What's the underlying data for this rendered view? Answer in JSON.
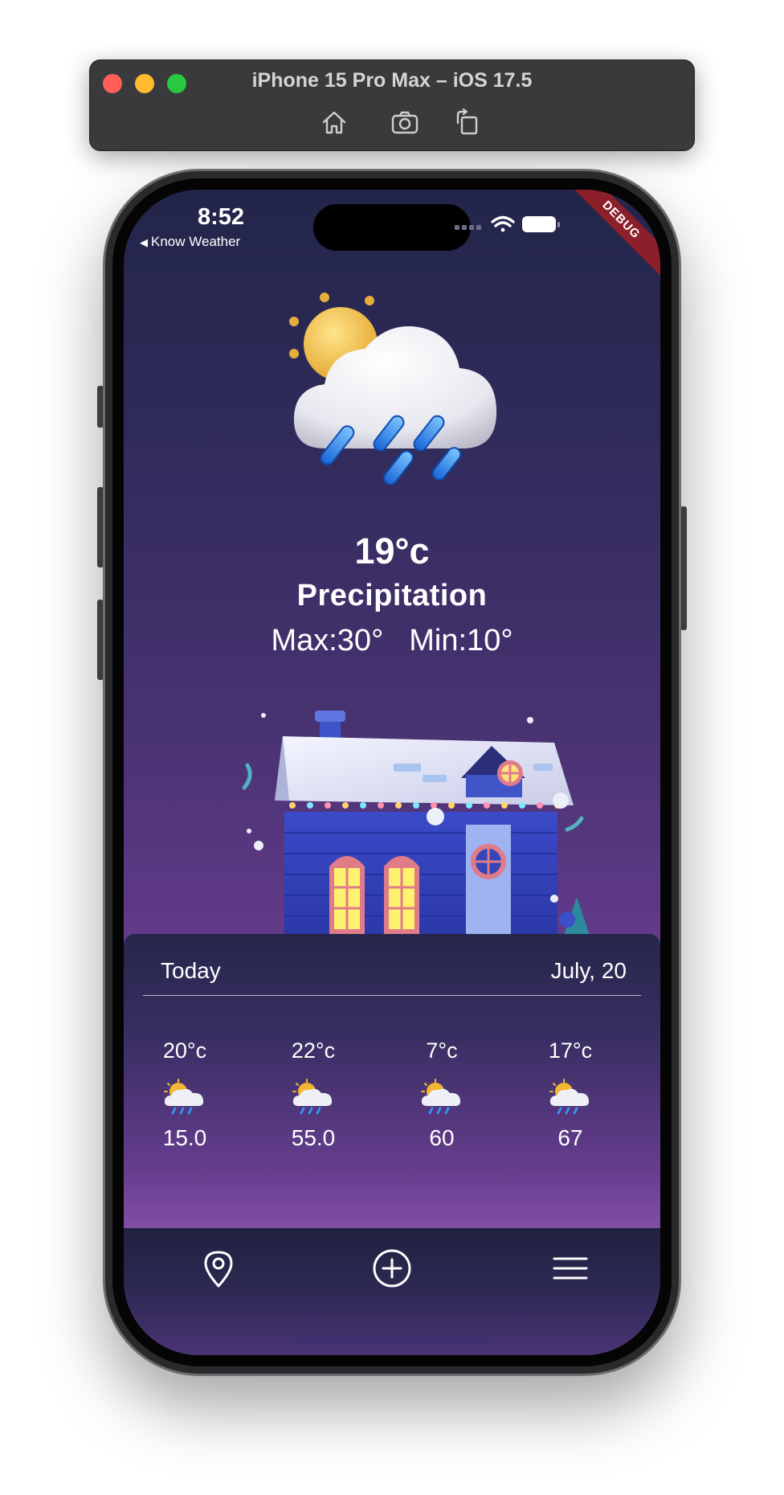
{
  "simulator": {
    "title": "iPhone 15 Pro Max – iOS 17.5",
    "toolbar_icons": [
      "home-icon",
      "screenshot-icon",
      "rotate-icon"
    ]
  },
  "status_bar": {
    "time": "8:52",
    "back_label": "Know Weather",
    "icons": [
      "cellular-icon",
      "wifi-icon",
      "battery-icon"
    ],
    "debug_banner": "DEBUG"
  },
  "current": {
    "illustration": "sun-cloud-rain-icon",
    "temperature": "19°c",
    "condition": "Precipitation",
    "max": "Max:30°",
    "min": "Min:10°",
    "scene": "snowy-house-illustration"
  },
  "forecast": {
    "day_label": "Today",
    "date_label": "July, 20",
    "items": [
      {
        "temp": "20°c",
        "icon": "sun-cloud-rain-icon",
        "value": "15.0"
      },
      {
        "temp": "22°c",
        "icon": "sun-cloud-rain-icon",
        "value": "55.0"
      },
      {
        "temp": "7°c",
        "icon": "sun-cloud-rain-icon",
        "value": "60"
      },
      {
        "temp": "17°c",
        "icon": "sun-cloud-rain-icon",
        "value": "67"
      }
    ]
  },
  "bottom_nav": {
    "items": [
      "location-pin-icon",
      "add-circle-icon",
      "menu-icon"
    ]
  },
  "colors": {
    "background_top": "#222549",
    "background_bottom": "#8c4eab",
    "debug_ribbon": "#8b1f2a",
    "text": "#ffffff"
  }
}
